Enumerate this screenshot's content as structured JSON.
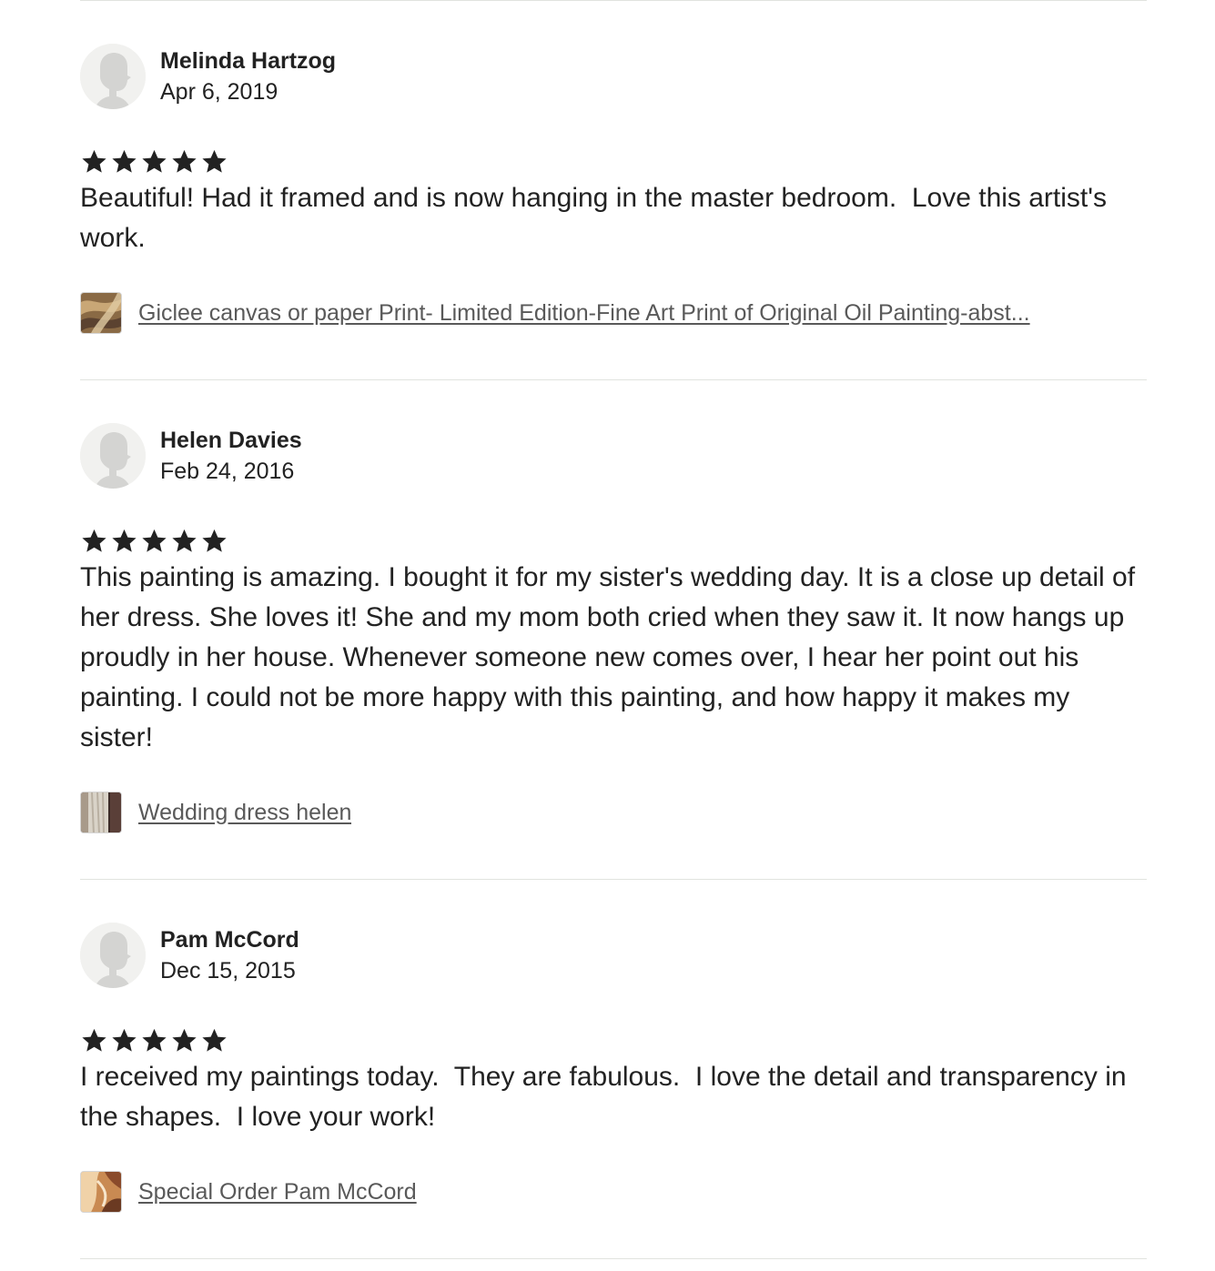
{
  "reviews": [
    {
      "reviewer": "Melinda Hartzog",
      "date": "Apr 6, 2019",
      "rating": 5,
      "text": "Beautiful! Had it framed and is now hanging in the master bedroom.  Love this artist's work.",
      "listing_title": "Giclee canvas or paper  Print- Limited Edition-Fine Art Print of Original Oil Painting-abst..."
    },
    {
      "reviewer": "Helen Davies",
      "date": "Feb 24, 2016",
      "rating": 5,
      "text": "This painting is amazing. I bought it for my sister's wedding day. It is a close up detail of her dress. She loves it! She and my mom both cried when they saw it. It now hangs up proudly in her house. Whenever someone new comes over, I hear her point out his painting. I could not be more happy with this painting, and how happy it makes my sister!",
      "listing_title": "Wedding dress helen"
    },
    {
      "reviewer": "Pam McCord",
      "date": "Dec 15, 2015",
      "rating": 5,
      "text": "I received my paintings today.  They are fabulous.  I love the detail and transparency in the shapes.  I love your work!",
      "listing_title": "Special Order Pam McCord"
    }
  ],
  "icons": {
    "avatar": "default-user-avatar-icon",
    "star": "star-filled-icon"
  },
  "colors": {
    "text": "#222222",
    "link": "#595959",
    "divider": "#e1e3df",
    "avatar_bg": "#f1f1ef",
    "avatar_figure": "#d4d4d2"
  }
}
